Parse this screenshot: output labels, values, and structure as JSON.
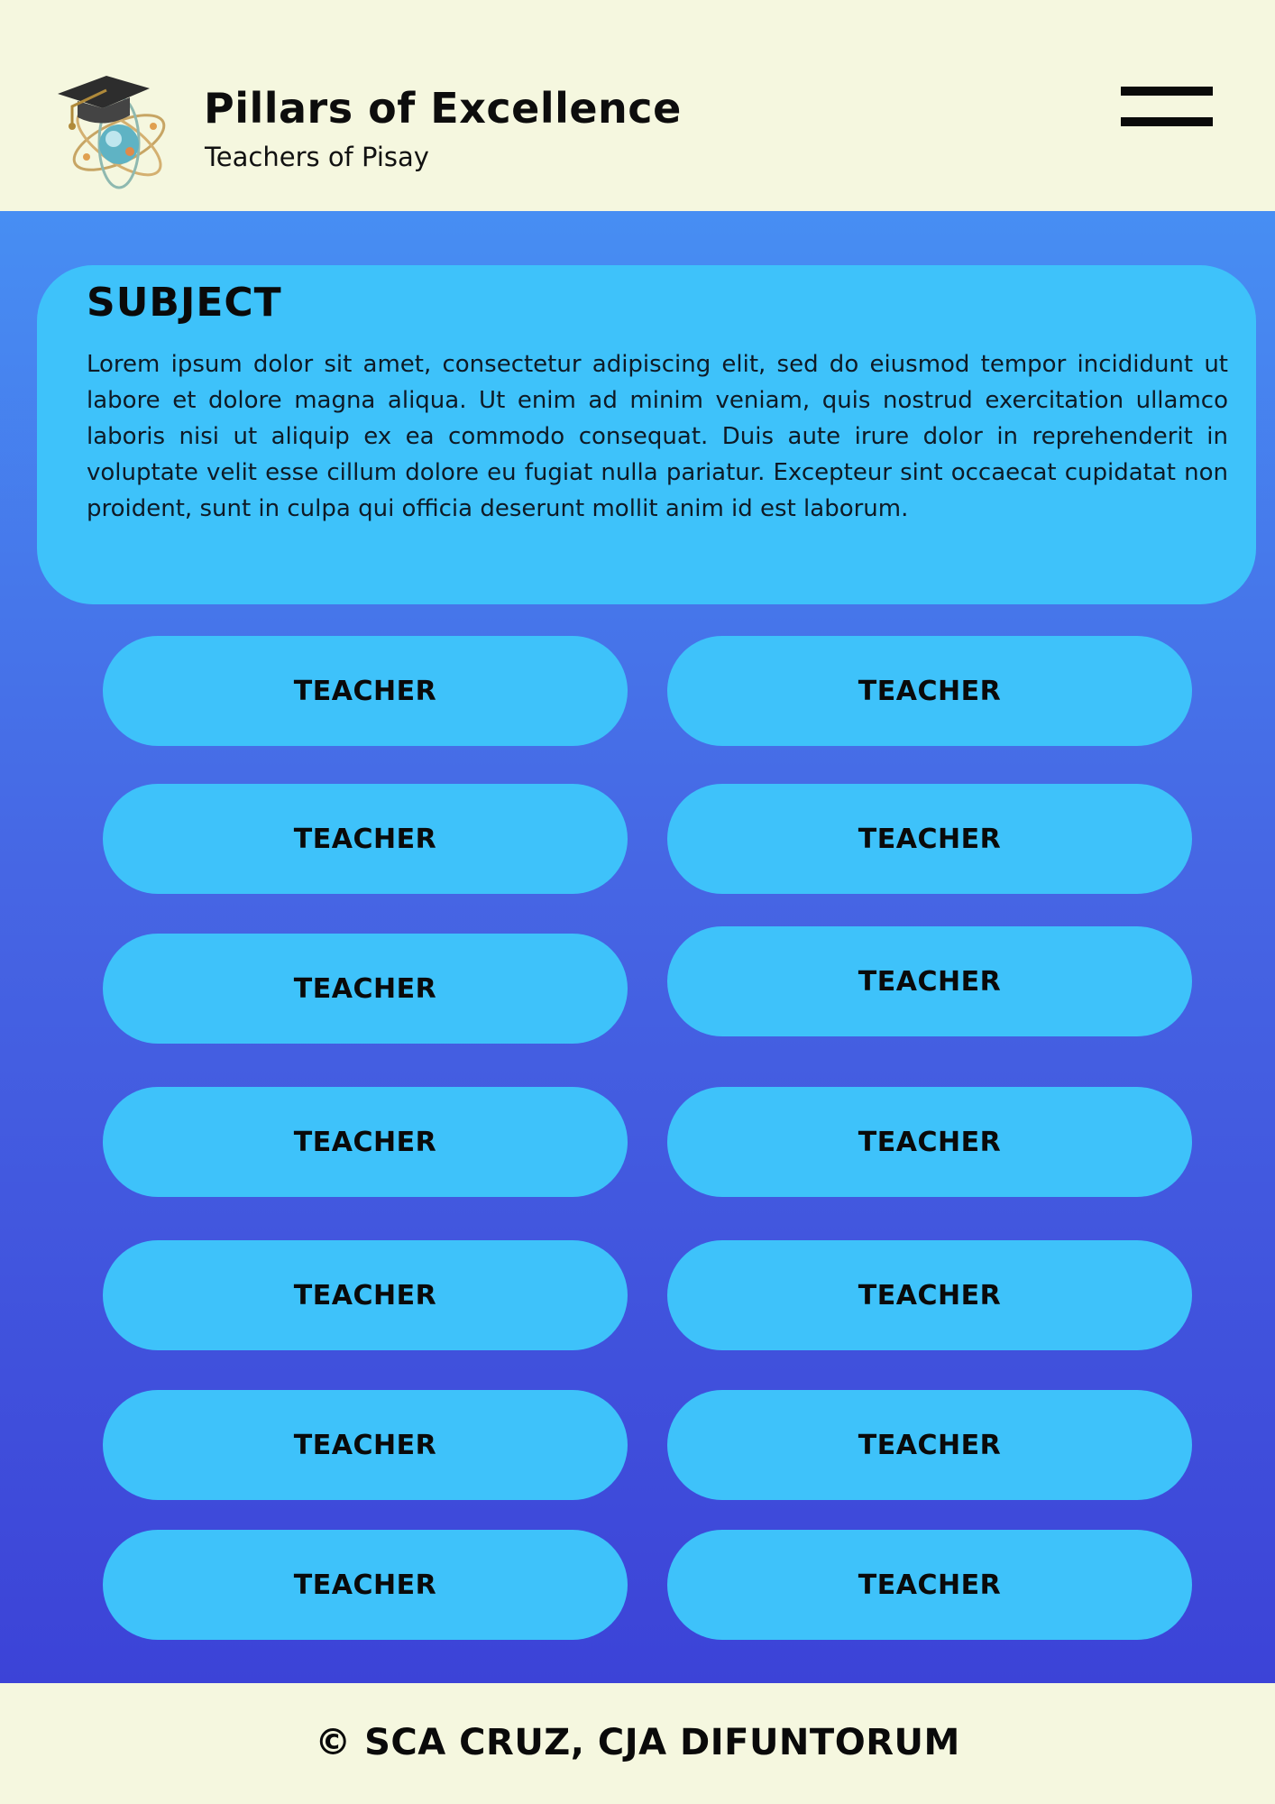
{
  "header": {
    "title": "Pillars of Excellence",
    "subtitle": "Teachers of Pisay",
    "logo_icon": "graduation-cap-atom-icon",
    "menu_icon": "menu-icon"
  },
  "subject": {
    "title": "SUBJECT",
    "body": "Lorem ipsum dolor sit amet, consectetur adipiscing elit, sed do eiusmod tempor incididunt ut labore et dolore magna aliqua. Ut enim ad minim veniam, quis nostrud exercitation ullamco laboris nisi ut aliquip ex ea commodo consequat. Duis aute irure dolor in reprehenderit in voluptate velit esse cillum dolore eu fugiat nulla pariatur. Excepteur sint occaecat cupidatat non proident, sunt in culpa qui officia deserunt mollit anim id est laborum."
  },
  "teachers": [
    "TEACHER",
    "TEACHER",
    "TEACHER",
    "TEACHER",
    "TEACHER",
    "TEACHER",
    "TEACHER",
    "TEACHER",
    "TEACHER",
    "TEACHER",
    "TEACHER",
    "TEACHER",
    "TEACHER",
    "TEACHER"
  ],
  "footer": {
    "copyright": "© SCA CRUZ, CJA DIFUNTORUM"
  },
  "colors": {
    "header_bg": "#f5f7df",
    "card_bg": "#3ec2fa",
    "gradient_top": "#478ef3",
    "gradient_bottom": "#3c43d7",
    "text": "#0a0a0a"
  }
}
